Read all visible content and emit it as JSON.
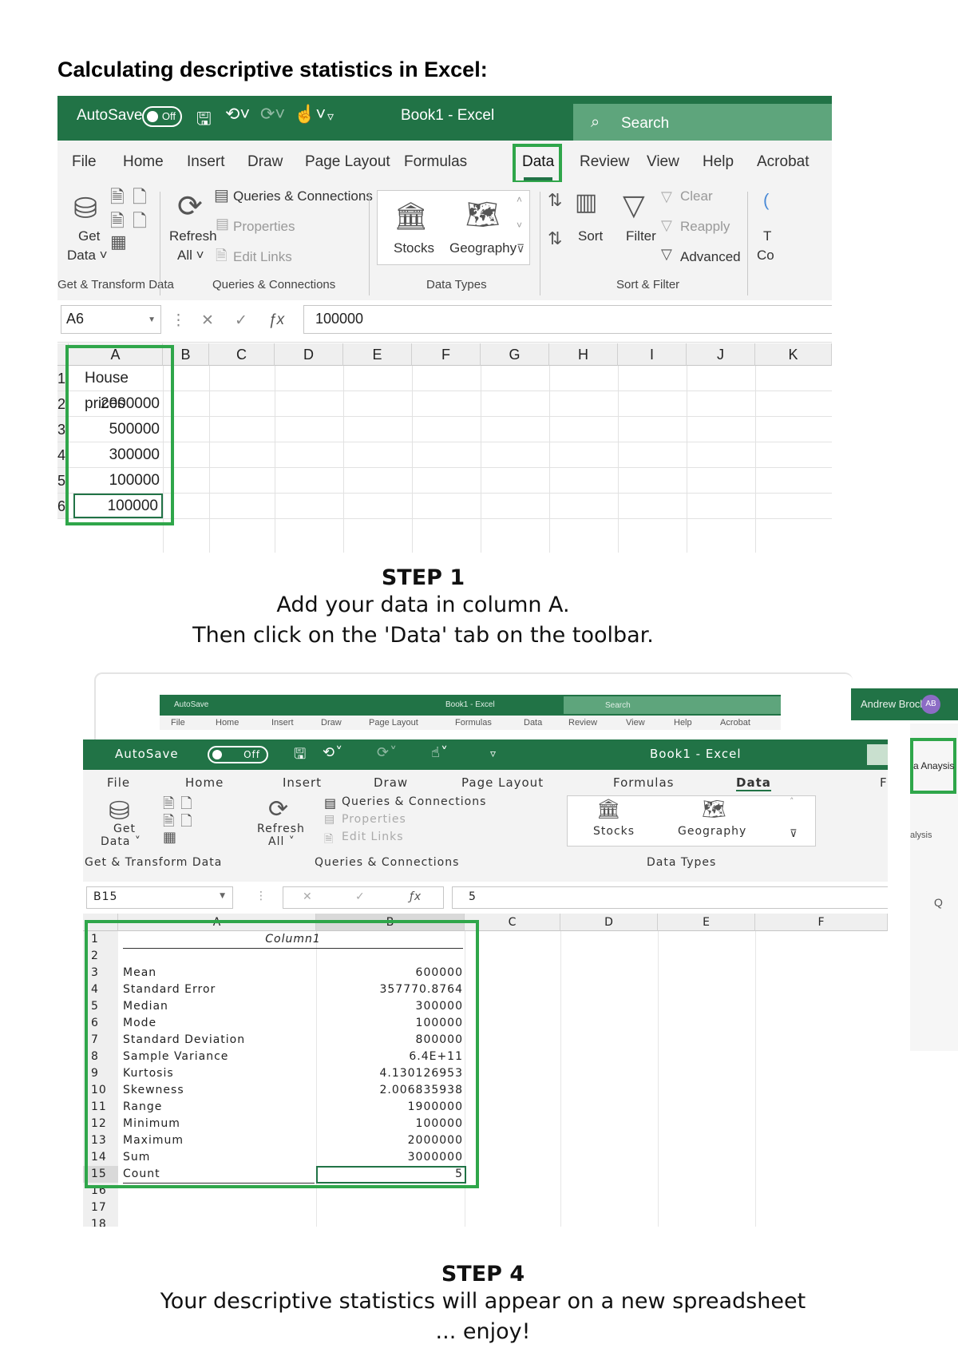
{
  "doc_title": "Calculating descriptive statistics in Excel:",
  "shot1": {
    "autosave_label": "AutoSave",
    "autosave_state": "Off",
    "window_title": "Book1  -  Excel",
    "search_placeholder": "Search",
    "menu": [
      "File",
      "Home",
      "Insert",
      "Draw",
      "Page Layout",
      "Formulas",
      "Data",
      "Review",
      "View",
      "Help",
      "Acrobat"
    ],
    "ribbon": {
      "get_data_1": "Get",
      "get_data_2": "Data ˅",
      "refresh_1": "Refresh",
      "refresh_2": "All ˅",
      "queries": "Queries & Connections",
      "properties": "Properties",
      "edit_links": "Edit Links",
      "stocks": "Stocks",
      "geography": "Geography",
      "sort": "Sort",
      "filter": "Filter",
      "clear": "Clear",
      "reapply": "Reapply",
      "advanced": "Advanced",
      "group_get": "Get & Transform Data",
      "group_queries": "Queries & Connections",
      "group_types": "Data Types",
      "group_sort": "Sort & Filter"
    },
    "name_box": "A6",
    "formula_value": "100000",
    "columns": [
      "A",
      "B",
      "C",
      "D",
      "E",
      "F",
      "G",
      "H",
      "I",
      "J",
      "K"
    ],
    "rows": [
      {
        "n": "1",
        "a": "House prices"
      },
      {
        "n": "2",
        "a": "2000000"
      },
      {
        "n": "3",
        "a": "500000"
      },
      {
        "n": "4",
        "a": "300000"
      },
      {
        "n": "5",
        "a": "100000"
      },
      {
        "n": "6",
        "a": "100000"
      }
    ]
  },
  "step1": {
    "heading": "STEP 1",
    "line1": "Add your data in column A.",
    "line2": "Then click on the 'Data' tab on the toolbar."
  },
  "bg_window": {
    "title": "Book1 - Excel",
    "autosave": "AutoSave",
    "search": "Search",
    "menu": [
      "File",
      "Home",
      "Insert",
      "Draw",
      "Page Layout",
      "Formulas",
      "Data",
      "Review",
      "View",
      "Help",
      "Acrobat"
    ],
    "user": "Andrew Brock",
    "user_initials": "AB",
    "analysis_label": "a Anaysis",
    "analysis_sub": "alysis",
    "col_q": "Q"
  },
  "shot2": {
    "autosave_label": "AutoSave",
    "autosave_state": "Off",
    "window_title": "Book1  -  Excel",
    "menu": [
      "File",
      "Home",
      "Insert",
      "Draw",
      "Page Layout",
      "Formulas",
      "Data",
      "F"
    ],
    "ribbon": {
      "get_data_1": "Get",
      "get_data_2": "Data ˅",
      "refresh_1": "Refresh",
      "refresh_2": "All ˅",
      "queries": "Queries & Connections",
      "properties": "Properties",
      "edit_links": "Edit Links",
      "stocks": "Stocks",
      "geography": "Geography",
      "group_get": "Get & Transform Data",
      "group_queries": "Queries & Connections",
      "group_types": "Data Types"
    },
    "name_box": "B15",
    "formula_value": "5",
    "columns": [
      "A",
      "B",
      "C",
      "D",
      "E",
      "F"
    ],
    "header_cell": "Column1",
    "rows": [
      {
        "n": "1",
        "label": "",
        "value": ""
      },
      {
        "n": "2",
        "label": "",
        "value": ""
      },
      {
        "n": "3",
        "label": "Mean",
        "value": "600000"
      },
      {
        "n": "4",
        "label": "Standard Error",
        "value": "357770.8764"
      },
      {
        "n": "5",
        "label": "Median",
        "value": "300000"
      },
      {
        "n": "6",
        "label": "Mode",
        "value": "100000"
      },
      {
        "n": "7",
        "label": "Standard Deviation",
        "value": "800000"
      },
      {
        "n": "8",
        "label": "Sample Variance",
        "value": "6.4E+11"
      },
      {
        "n": "9",
        "label": "Kurtosis",
        "value": "4.130126953"
      },
      {
        "n": "10",
        "label": "Skewness",
        "value": "2.006835938"
      },
      {
        "n": "11",
        "label": "Range",
        "value": "1900000"
      },
      {
        "n": "12",
        "label": "Minimum",
        "value": "100000"
      },
      {
        "n": "13",
        "label": "Maximum",
        "value": "2000000"
      },
      {
        "n": "14",
        "label": "Sum",
        "value": "3000000"
      },
      {
        "n": "15",
        "label": "Count",
        "value": "5"
      },
      {
        "n": "16",
        "label": "",
        "value": ""
      },
      {
        "n": "17",
        "label": "",
        "value": ""
      },
      {
        "n": "18",
        "label": "",
        "value": ""
      }
    ]
  },
  "step4": {
    "heading": "STEP 4",
    "line1": "Your descriptive statistics will appear on a new spreadsheet",
    "line2": "... enjoy!"
  }
}
